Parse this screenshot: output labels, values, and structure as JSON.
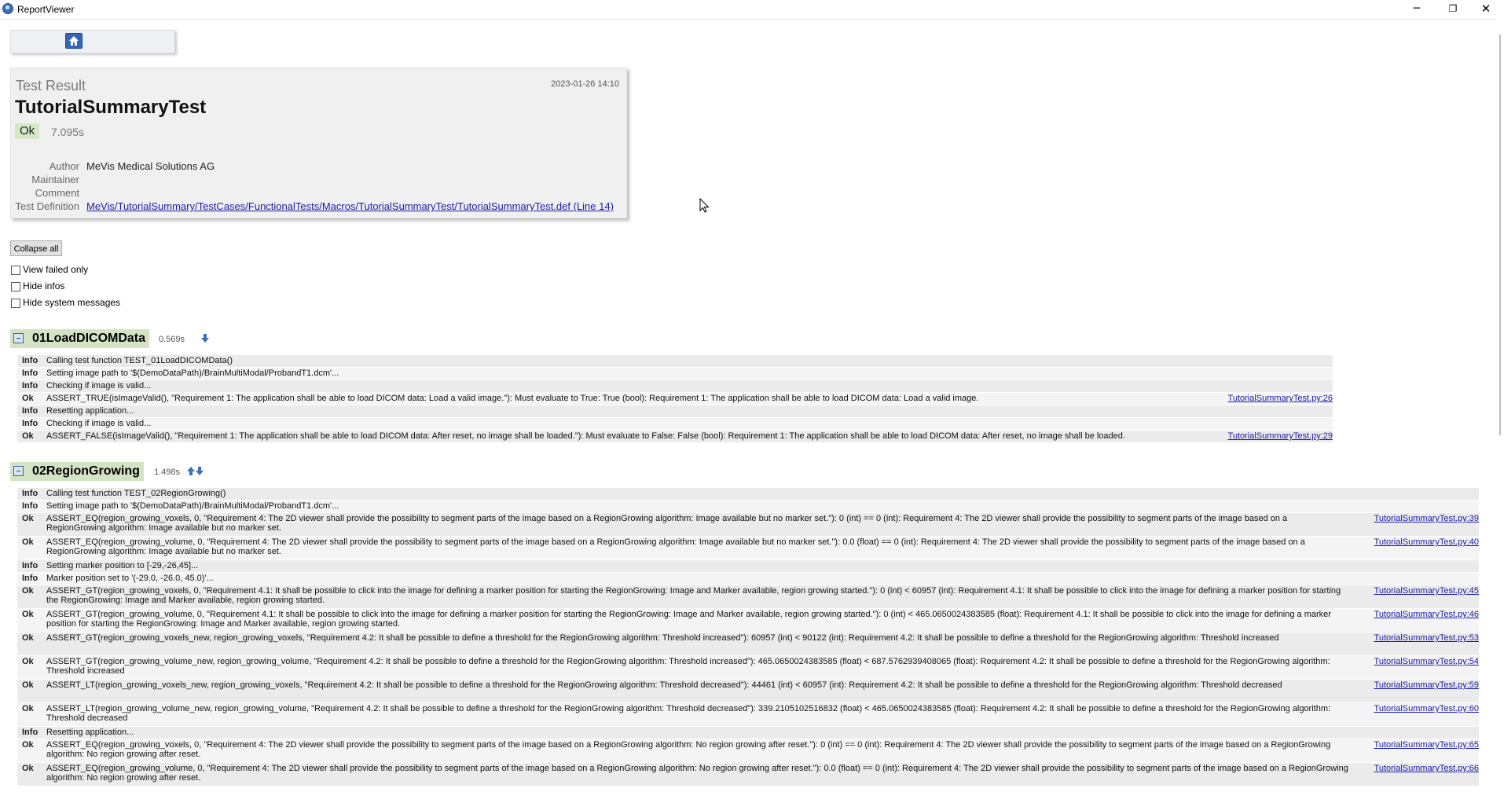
{
  "window": {
    "title": "ReportViewer",
    "minimize": "─",
    "maximize": "❐",
    "close": "✕"
  },
  "header": {
    "label": "Test Result",
    "date": "2023-01-26 14:10",
    "test_name": "TutorialSummaryTest",
    "status": "Ok",
    "duration": "7.095s",
    "meta": [
      {
        "label": "Author",
        "value": "MeVis Medical Solutions AG"
      },
      {
        "label": "Maintainer",
        "value": ""
      },
      {
        "label": "Comment",
        "value": ""
      },
      {
        "label": "Test Definition",
        "value": "MeVis/TutorialSummary/TestCases/FunctionalTests/Macros/TutorialSummaryTest/TutorialSummaryTest.def (Line 14)"
      }
    ]
  },
  "controls": {
    "collapse_all": "Collapse all",
    "view_failed_only": "View failed only",
    "hide_infos": "Hide infos",
    "hide_system_messages": "Hide system messages"
  },
  "sections": [
    {
      "title": "01LoadDICOMData",
      "duration": "0.569s",
      "rows": [
        {
          "type": "Info",
          "msg": "Calling test function TEST_01LoadDICOMData()",
          "link": ""
        },
        {
          "type": "Info",
          "msg": "Setting image path to '$(DemoDataPath)/BrainMultiModal/ProbandT1.dcm'...",
          "link": ""
        },
        {
          "type": "Info",
          "msg": "Checking if image is valid...",
          "link": ""
        },
        {
          "type": "Ok",
          "msg": "ASSERT_TRUE(isImageValid(), \"Requirement 1: The application shall be able to load DICOM data: Load a valid image.\"): Must evaluate to True: True (bool): Requirement 1: The application shall be able to load DICOM data: Load a valid image.",
          "link": "TutorialSummaryTest.py:26"
        },
        {
          "type": "Info",
          "msg": "Resetting application...",
          "link": ""
        },
        {
          "type": "Info",
          "msg": "Checking if image is valid...",
          "link": ""
        },
        {
          "type": "Ok",
          "msg": "ASSERT_FALSE(isImageValid(), \"Requirement 1: The application shall be able to load DICOM data: After reset, no image shall be loaded.\"): Must evaluate to False: False (bool): Requirement 1: The application shall be able to load DICOM data: After reset, no image shall be loaded.",
          "link": "TutorialSummaryTest.py:29"
        }
      ]
    },
    {
      "title": "02RegionGrowing",
      "duration": "1.498s",
      "rows": [
        {
          "type": "Info",
          "msg": "Calling test function TEST_02RegionGrowing()",
          "link": ""
        },
        {
          "type": "Info",
          "msg": "Setting image path to '$(DemoDataPath)/BrainMultiModal/ProbandT1.dcm'...",
          "link": ""
        },
        {
          "type": "Ok",
          "msg": "ASSERT_EQ(region_growing_voxels, 0, \"Requirement 4: The 2D viewer shall provide the possibility to segment parts of the image based on a RegionGrowing algorithm: Image available but no marker set.\"): 0 (int) == 0 (int): Requirement 4: The 2D viewer shall provide the possibility to segment parts of the image based on a RegionGrowing algorithm: Image available but no marker set.",
          "link": "TutorialSummaryTest.py:39"
        },
        {
          "type": "Ok",
          "msg": "ASSERT_EQ(region_growing_volume, 0, \"Requirement 4: The 2D viewer shall provide the possibility to segment parts of the image based on a RegionGrowing algorithm: Image available but no marker set.\"): 0.0 (float) == 0 (int): Requirement 4: The 2D viewer shall provide the possibility to segment parts of the image based on a RegionGrowing algorithm: Image available but no marker set.",
          "link": "TutorialSummaryTest.py:40"
        },
        {
          "type": "Info",
          "msg": "Setting marker position to [-29,-26,45]...",
          "link": ""
        },
        {
          "type": "Info",
          "msg": "Marker position set to '(-29.0, -26.0, 45.0)'...",
          "link": ""
        },
        {
          "type": "Ok",
          "msg": "ASSERT_GT(region_growing_voxels, 0, \"Requirement 4.1: It shall be possible to click into the image for defining a marker position for starting the RegionGrowing: Image and Marker available, region growing started.\"): 0 (int) < 60957 (int): Requirement 4.1: It shall be possible to click into the image for defining a marker position for starting the RegionGrowing: Image and Marker available, region growing started.",
          "link": "TutorialSummaryTest.py:45"
        },
        {
          "type": "Ok",
          "msg": "ASSERT_GT(region_growing_volume, 0, \"Requirement 4.1: It shall be possible to click into the image for defining a marker position for starting the RegionGrowing: Image and Marker available, region growing started.\"): 0 (int) < 465.0650024383585 (float): Requirement 4.1: It shall be possible to click into the image for defining a marker position for starting the RegionGrowing: Image and Marker available, region growing started.",
          "link": "TutorialSummaryTest.py:46"
        },
        {
          "type": "Ok",
          "msg": "ASSERT_GT(region_growing_voxels_new, region_growing_voxels, \"Requirement 4.2: It shall be possible to define a threshold for the RegionGrowing algorithm: Threshold increased\"): 60957 (int) < 90122 (int): Requirement 4.2: It shall be possible to define a threshold for the RegionGrowing algorithm: Threshold increased",
          "link": "TutorialSummaryTest.py:53"
        },
        {
          "type": "Ok",
          "msg": "ASSERT_GT(region_growing_volume_new, region_growing_volume, \"Requirement 4.2: It shall be possible to define a threshold for the RegionGrowing algorithm: Threshold increased\"): 465.0650024383585 (float) < 687.5762939408065 (float): Requirement 4.2: It shall be possible to define a threshold for the RegionGrowing algorithm: Threshold increased",
          "link": "TutorialSummaryTest.py:54"
        },
        {
          "type": "Ok",
          "msg": "ASSERT_LT(region_growing_voxels_new, region_growing_voxels, \"Requirement 4.2: It shall be possible to define a threshold for the RegionGrowing algorithm: Threshold decreased\"): 44461 (int) < 60957 (int): Requirement 4.2: It shall be possible to define a threshold for the RegionGrowing algorithm: Threshold decreased",
          "link": "TutorialSummaryTest.py:59"
        },
        {
          "type": "Ok",
          "msg": "ASSERT_LT(region_growing_volume_new, region_growing_volume, \"Requirement 4.2: It shall be possible to define a threshold for the RegionGrowing algorithm: Threshold decreased\"): 339.2105102516832 (float) < 465.0650024383585 (float): Requirement 4.2: It shall be possible to define a threshold for the RegionGrowing algorithm: Threshold decreased",
          "link": "TutorialSummaryTest.py:60"
        },
        {
          "type": "Info",
          "msg": "Resetting application...",
          "link": ""
        },
        {
          "type": "Ok",
          "msg": "ASSERT_EQ(region_growing_voxels, 0, \"Requirement 4: The 2D viewer shall provide the possibility to segment parts of the image based on a RegionGrowing algorithm: No region growing after reset.\"): 0 (int) == 0 (int): Requirement 4: The 2D viewer shall provide the possibility to segment parts of the image based on a RegionGrowing algorithm: No region growing after reset.",
          "link": "TutorialSummaryTest.py:65"
        },
        {
          "type": "Ok",
          "msg": "ASSERT_EQ(region_growing_volume, 0, \"Requirement 4: The 2D viewer shall provide the possibility to segment parts of the image based on a RegionGrowing algorithm: No region growing after reset.\"): 0.0 (float) == 0 (int): Requirement 4: The 2D viewer shall provide the possibility to segment parts of the image based on a RegionGrowing algorithm: No region growing after reset.",
          "link": "TutorialSummaryTest.py:66"
        }
      ]
    }
  ],
  "colors": {
    "ok_badge": "#d5e8c6",
    "section_header": "#d3e3c4",
    "row_bg": "#ebebeb",
    "link": "#1a1aa6",
    "home_icon": "#3466b5"
  },
  "icons": {
    "home": "home-icon",
    "down": "arrow-down-icon",
    "up_down": "arrow-up-down-icon",
    "collapse": "collapse-minus-icon"
  }
}
